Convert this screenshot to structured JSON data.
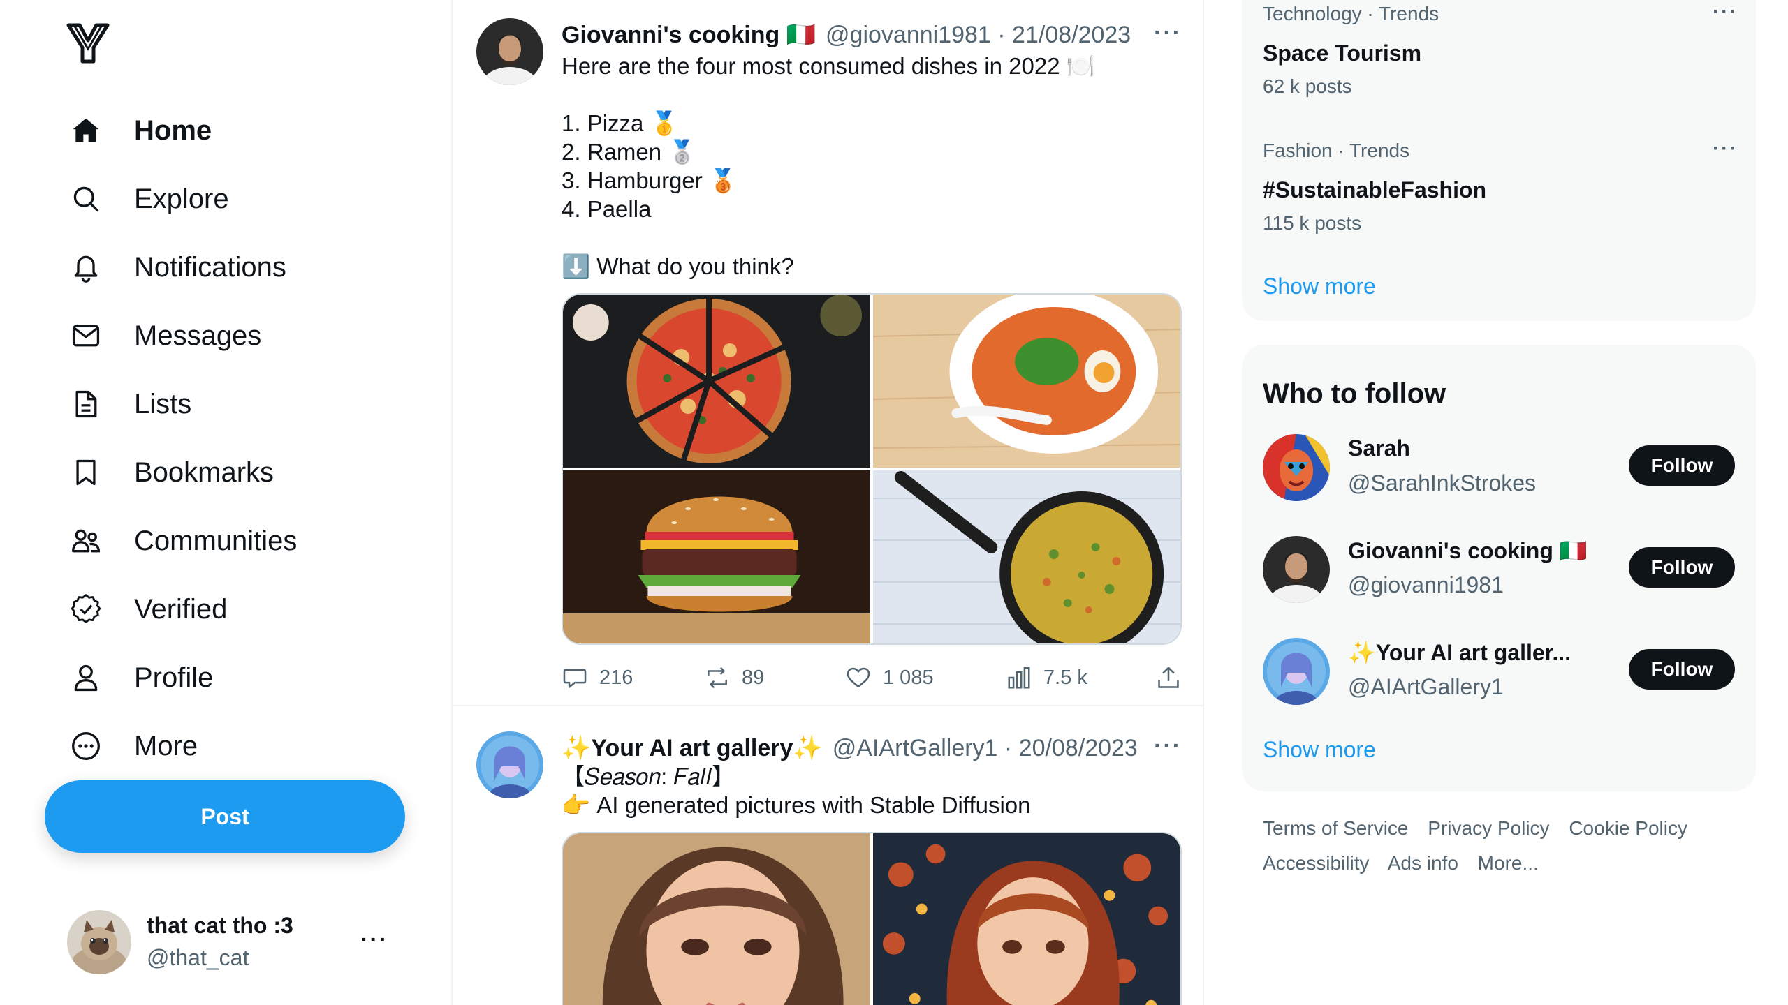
{
  "sidebar": {
    "logo": "Y",
    "nav": [
      {
        "label": "Home",
        "icon": "home-icon",
        "active": true
      },
      {
        "label": "Explore",
        "icon": "search-icon"
      },
      {
        "label": "Notifications",
        "icon": "bell-icon"
      },
      {
        "label": "Messages",
        "icon": "envelope-icon"
      },
      {
        "label": "Lists",
        "icon": "list-document-icon"
      },
      {
        "label": "Bookmarks",
        "icon": "bookmark-icon"
      },
      {
        "label": "Communities",
        "icon": "people-icon"
      },
      {
        "label": "Verified",
        "icon": "verified-badge-icon"
      },
      {
        "label": "Profile",
        "icon": "person-icon"
      },
      {
        "label": "More",
        "icon": "more-circle-icon"
      }
    ],
    "post_button": "Post",
    "account": {
      "name": "that cat tho :3",
      "handle": "@that_cat",
      "more": "···"
    }
  },
  "feed": {
    "posts": [
      {
        "name": "Giovanni's cooking 🇮🇹",
        "meta": "@giovanni1981 · 21/08/2023",
        "text": "Here are the four most consumed dishes in 2022 🍽️\n\n1. Pizza 🥇\n2. Ramen 🥈\n3. Hamburger 🥉\n4. Paella\n\n⬇️ What do you think?",
        "images": [
          "pizza",
          "ramen",
          "hamburger",
          "paella"
        ],
        "replies": "216",
        "reposts": "89",
        "likes": "1 085",
        "views": "7.5 k"
      },
      {
        "name": "✨Your AI art gallery✨",
        "meta": "@AIArtGallery1 · 20/08/2023",
        "text": "【𝑆𝑒𝑎𝑠𝑜𝑛: 𝐹𝑎𝑙𝑙】\n👉 AI generated pictures with Stable Diffusion",
        "images": [
          "girl-portrait",
          "girl-autumn"
        ]
      }
    ]
  },
  "trends": {
    "items": [
      {
        "category": "Technology · Trends",
        "title": "Space Tourism",
        "count": "62 k posts"
      },
      {
        "category": "Fashion · Trends",
        "title": "#SustainableFashion",
        "count": "115 k posts"
      }
    ],
    "show_more": "Show more"
  },
  "who_to_follow": {
    "title": "Who to follow",
    "users": [
      {
        "name": "Sarah",
        "handle": "@SarahInkStrokes",
        "button": "Follow"
      },
      {
        "name": "Giovanni's cooking 🇮🇹",
        "handle": "@giovanni1981",
        "button": "Follow"
      },
      {
        "name": "✨Your AI art galler...",
        "handle": "@AIArtGallery1",
        "button": "Follow"
      }
    ],
    "show_more": "Show more"
  },
  "footer": {
    "links": [
      "Terms of Service",
      "Privacy Policy",
      "Cookie Policy",
      "Accessibility",
      "Ads info",
      "More..."
    ]
  },
  "colors": {
    "accent": "#1d9bf0",
    "text": "#0f1419",
    "muted": "#536471",
    "panel": "#f7f9f9"
  }
}
